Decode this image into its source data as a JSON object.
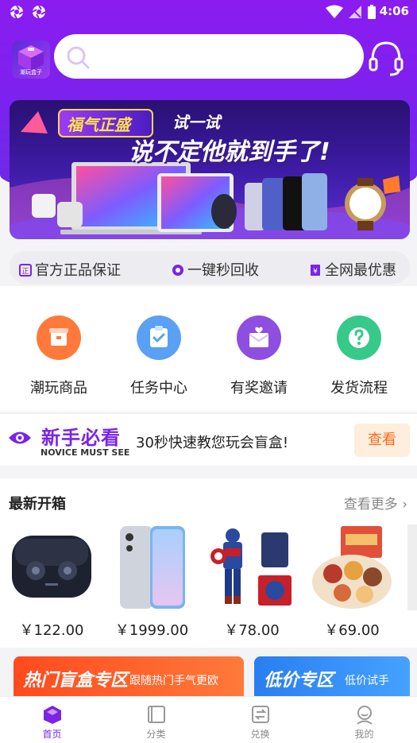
{
  "status": {
    "time": "4:06"
  },
  "logo": {
    "text": "潮玩盒子"
  },
  "search": {
    "placeholder": ""
  },
  "banner": {
    "tag": "福气正盛",
    "try": "试一试",
    "slogan": "说不定他就到手了!"
  },
  "guarantees": [
    "官方正品保证",
    "一键秒回收",
    "全网最优惠"
  ],
  "categories": [
    {
      "label": "潮玩商品",
      "icon": "box-icon",
      "color": "#ff7a3a"
    },
    {
      "label": "任务中心",
      "icon": "task-icon",
      "color": "#5aa0f5"
    },
    {
      "label": "有奖邀请",
      "icon": "invite-icon",
      "color": "#8e4fe0"
    },
    {
      "label": "发货流程",
      "icon": "help-icon",
      "color": "#36c98a"
    }
  ],
  "novice": {
    "title": "新手必看",
    "subtitle": "NOVICE MUST SEE",
    "desc": "30秒快速教您玩会盲盒!",
    "button": "查看"
  },
  "newest": {
    "title": "最新开箱",
    "more": "查看更多",
    "products": [
      {
        "name": "earbuds-image",
        "price": "￥122.00"
      },
      {
        "name": "phone-image",
        "price": "￥1999.00"
      },
      {
        "name": "figure-image",
        "price": "￥78.00"
      },
      {
        "name": "snacks-image",
        "price": "￥69.00"
      }
    ]
  },
  "promos": [
    {
      "title": "热门盲盒专区",
      "sub": "跟随热门手气更欧",
      "color": "#ff5a2a"
    },
    {
      "title": "低价专区",
      "sub": "低价试手",
      "color": "#2d8ef0"
    }
  ],
  "tabs": [
    {
      "label": "首页",
      "icon": "home-icon",
      "active": true
    },
    {
      "label": "分类",
      "icon": "category-icon",
      "active": false
    },
    {
      "label": "兑换",
      "icon": "exchange-icon",
      "active": false
    },
    {
      "label": "我的",
      "icon": "profile-icon",
      "active": false
    }
  ],
  "colors": {
    "primary": "#7b24e6",
    "accent": "#ff6a1a"
  }
}
